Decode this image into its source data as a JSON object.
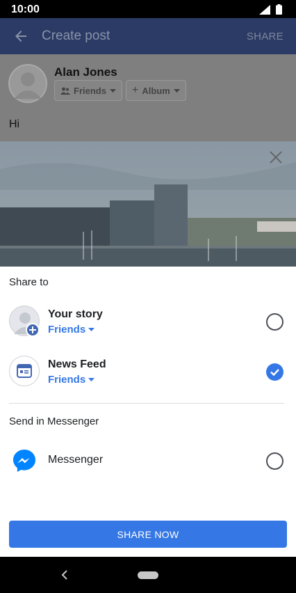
{
  "status_bar": {
    "time": "10:00"
  },
  "app_bar": {
    "title": "Create post",
    "share_label": "SHARE"
  },
  "composer": {
    "author_name": "Alan Jones",
    "audience_chip": "Friends",
    "album_chip": "Album",
    "post_text": "Hi"
  },
  "share_sheet": {
    "share_to_title": "Share to",
    "options": [
      {
        "title": "Your story",
        "audience": "Friends",
        "selected": false
      },
      {
        "title": "News Feed",
        "audience": "Friends",
        "selected": true
      }
    ],
    "send_in_messenger_title": "Send in Messenger",
    "messenger_label": "Messenger",
    "messenger_selected": false,
    "share_now_label": "SHARE NOW"
  },
  "colors": {
    "accent": "#3578e5",
    "app_bar": "#2b3b66",
    "messenger": "#0084ff"
  }
}
